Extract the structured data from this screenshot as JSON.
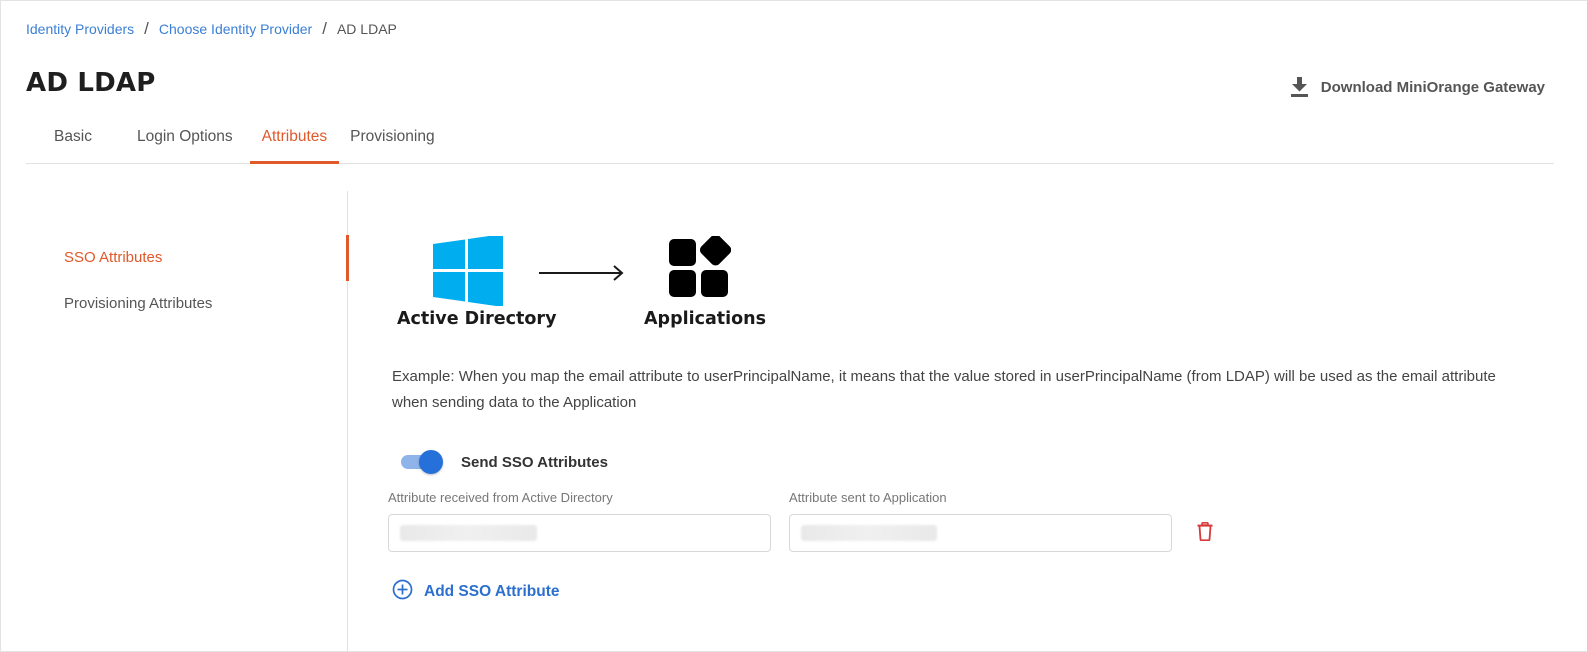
{
  "breadcrumb": {
    "items": [
      "Identity Providers",
      "Choose Identity Provider"
    ],
    "separator": "/",
    "current": "AD LDAP"
  },
  "header": {
    "title": "AD LDAP",
    "download_label": "Download MiniOrange Gateway",
    "download_icon": "download-icon"
  },
  "tabs": [
    {
      "label": "Basic"
    },
    {
      "label": "Login Options"
    },
    {
      "label": "Attributes",
      "active": true
    },
    {
      "label": "Provisioning"
    }
  ],
  "side_nav": {
    "items": [
      {
        "label": "SSO Attributes",
        "active": true
      },
      {
        "label": "Provisioning Attributes"
      }
    ]
  },
  "diagram": {
    "source_label": "Active Directory",
    "source_icon": "windows-logo-icon",
    "arrow_icon": "right-arrow-icon",
    "target_label": "Applications",
    "target_icon": "apps-grid-icon"
  },
  "example_text": "Example: When you map the email attribute to userPrincipalName, it means that the value stored in userPrincipalName (from LDAP) will be used as the email attribute when sending data to the Application",
  "sso": {
    "toggle_label": "Send SSO Attributes",
    "toggle_on": true,
    "ad_attribute_label": "Attribute received from Active Directory",
    "app_attribute_label": "Attribute sent to Application",
    "ad_attribute_value": "",
    "app_attribute_value": "",
    "delete_icon": "trash-icon",
    "add_label": "Add SSO Attribute",
    "add_icon": "plus-circle-icon"
  },
  "colors": {
    "accent": "#e0592a",
    "link": "#3b7fd6",
    "primary": "#2570d9",
    "danger": "#d63a3a",
    "windows": "#00adef"
  }
}
